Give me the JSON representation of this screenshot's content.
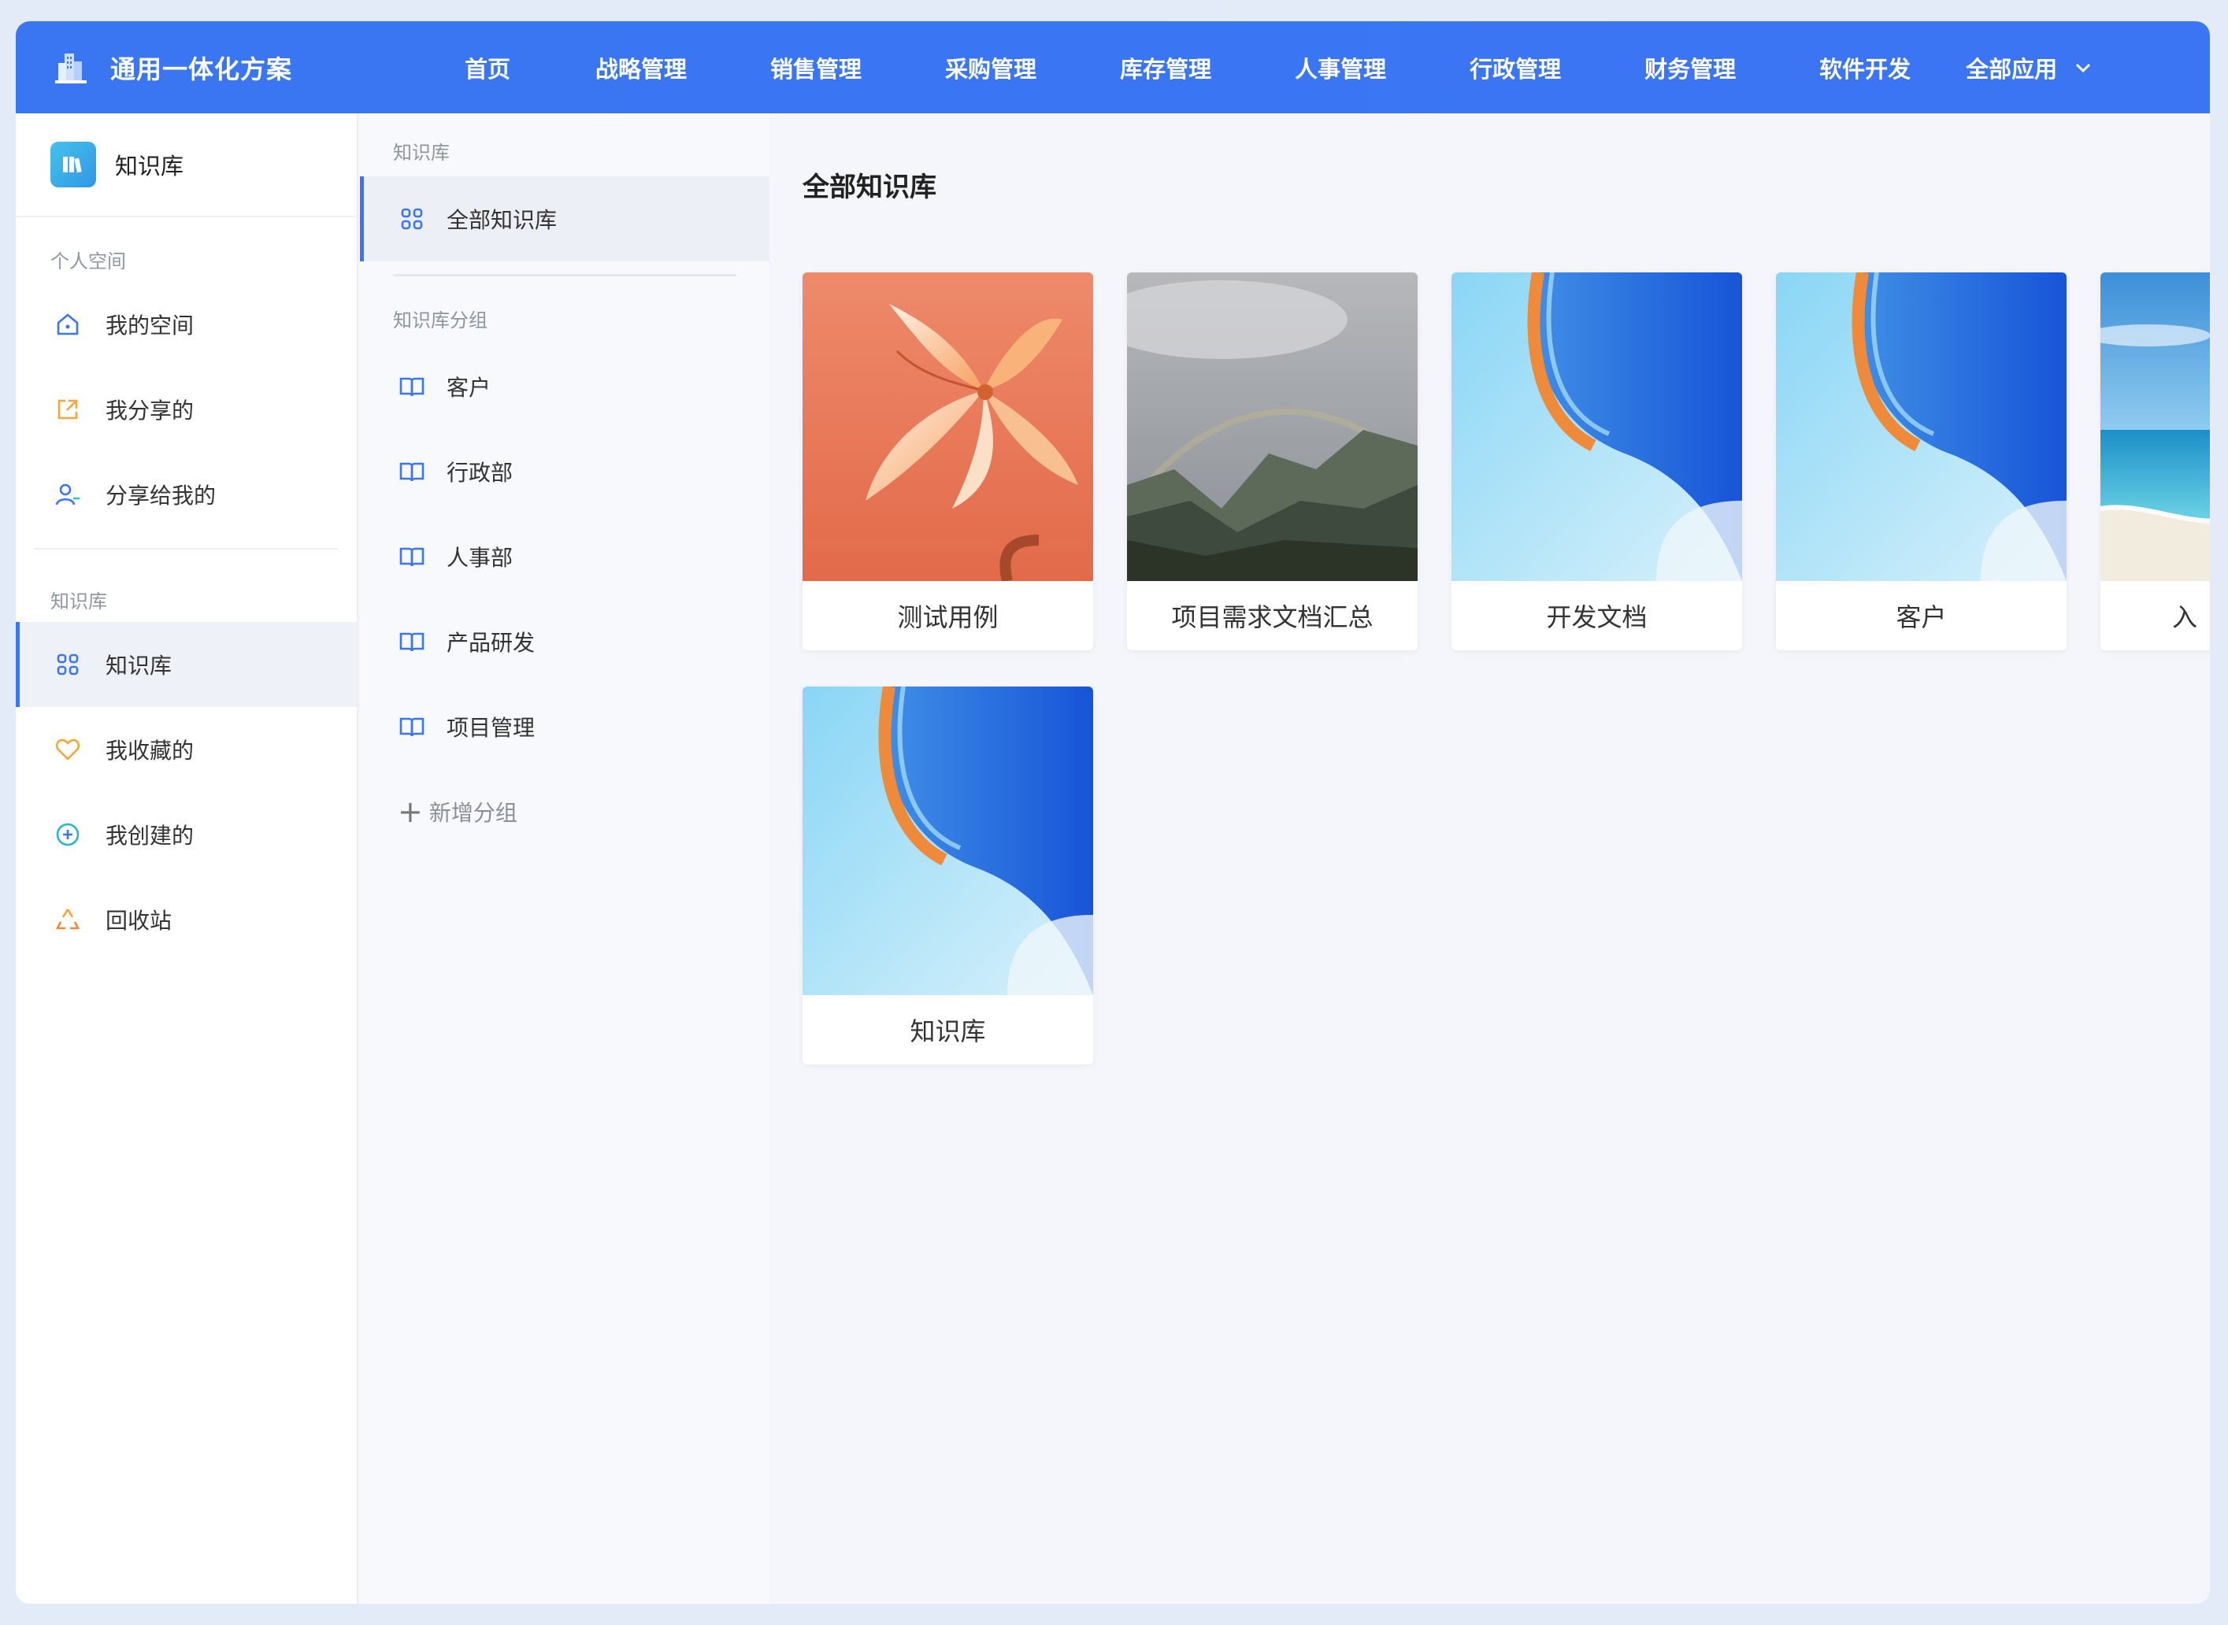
{
  "app": {
    "brand": "通用一体化方案"
  },
  "topnav": {
    "items": [
      "首页",
      "战略管理",
      "销售管理",
      "采购管理",
      "库存管理",
      "人事管理",
      "行政管理",
      "财务管理",
      "软件开发"
    ],
    "more_label": "全部应用"
  },
  "sidebar": {
    "header_title": "知识库",
    "personal_label": "个人空间",
    "personal_items": [
      {
        "label": "我的空间",
        "icon": "home-icon"
      },
      {
        "label": "我分享的",
        "icon": "share-out-icon"
      },
      {
        "label": "分享给我的",
        "icon": "user-share-icon"
      }
    ],
    "kb_label": "知识库",
    "kb_items": [
      {
        "label": "知识库",
        "icon": "grid-icon",
        "active": true
      },
      {
        "label": "我收藏的",
        "icon": "heart-icon"
      },
      {
        "label": "我创建的",
        "icon": "plus-circle-icon"
      },
      {
        "label": "回收站",
        "icon": "recycle-icon"
      }
    ]
  },
  "subsidebar": {
    "top_label": "知识库",
    "all_label": "全部知识库",
    "groups_label": "知识库分组",
    "groups": [
      "客户",
      "行政部",
      "人事部",
      "产品研发",
      "项目管理"
    ],
    "add_group_label": "新增分组"
  },
  "main": {
    "title": "全部知识库",
    "cards": [
      {
        "name": "测试用例",
        "thumb": "flower"
      },
      {
        "name": "项目需求文档汇总",
        "thumb": "mountain"
      },
      {
        "name": "开发文档",
        "thumb": "blue-wave"
      },
      {
        "name": "客户",
        "thumb": "blue-wave"
      },
      {
        "name": "入",
        "thumb": "ocean"
      },
      {
        "name": "知识库",
        "thumb": "blue-wave"
      }
    ]
  },
  "colors": {
    "accent": "#3b75f4",
    "topbar": "#3a76f2",
    "icon_blue": "#3b75f4",
    "icon_orange": "#f5a53b"
  }
}
